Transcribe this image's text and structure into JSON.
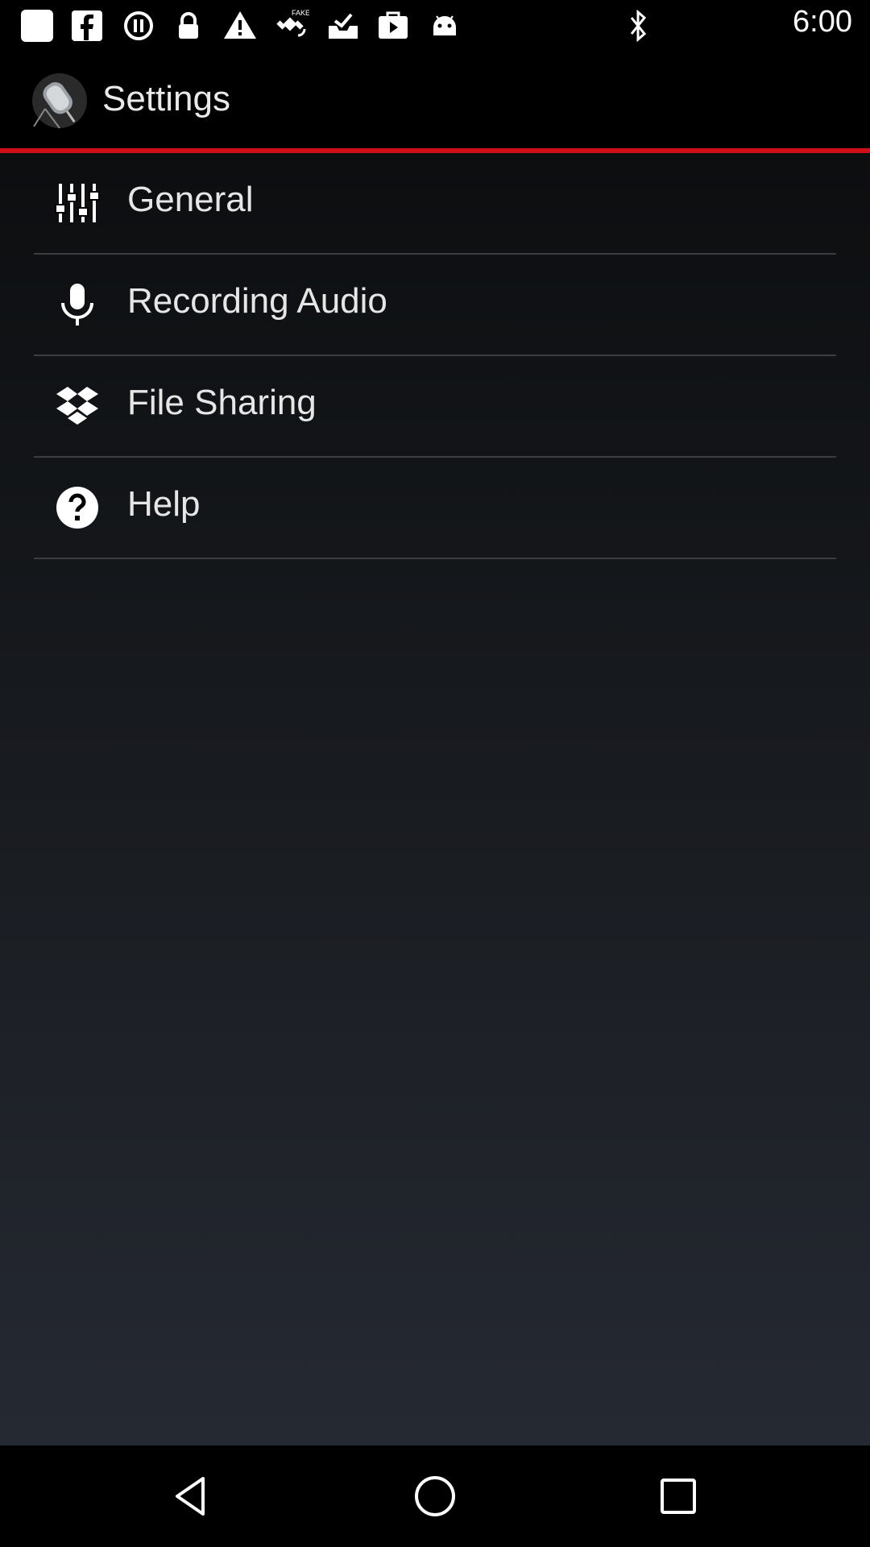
{
  "status_bar": {
    "time": "6:00",
    "icons": [
      "square-icon",
      "facebook-icon",
      "pause-circle-icon",
      "lock-icon",
      "warning-icon",
      "satellite-fake-gps-icon",
      "inbox-check-icon",
      "briefcase-play-icon",
      "android-icon",
      "bluetooth-icon"
    ]
  },
  "app_bar": {
    "title": "Settings",
    "logo_icon": "microphone-app-logo"
  },
  "accent_color": "#d10f18",
  "menu": {
    "items": [
      {
        "label": "General",
        "icon": "sliders-icon"
      },
      {
        "label": "Recording Audio",
        "icon": "microphone-icon"
      },
      {
        "label": "File Sharing",
        "icon": "dropbox-icon"
      },
      {
        "label": "Help",
        "icon": "help-circle-icon"
      }
    ]
  },
  "nav_bar": {
    "buttons": [
      "back-icon",
      "home-icon",
      "recents-icon"
    ]
  }
}
